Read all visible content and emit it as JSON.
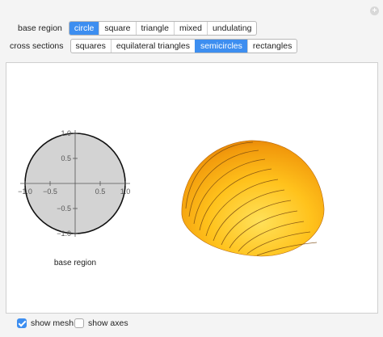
{
  "header": {
    "expand_icon": "plus-icon"
  },
  "controls": {
    "base_region": {
      "label": "base region",
      "options": [
        "circle",
        "square",
        "triangle",
        "mixed",
        "undulating"
      ],
      "selected": "circle"
    },
    "cross_sections": {
      "label": "cross sections",
      "options": [
        "squares",
        "equilateral triangles",
        "semicircles",
        "rectangles"
      ],
      "selected": "semicircles"
    }
  },
  "plot": {
    "x_ticks": [
      "−1.0",
      "−0.5",
      "0.5",
      "1.0"
    ],
    "y_ticks": [
      "1.0",
      "0.5",
      "−0.5",
      "−1.0"
    ],
    "caption": "base region"
  },
  "options": {
    "show_mesh": {
      "label": "show mesh",
      "checked": true
    },
    "show_axes": {
      "label": "show axes",
      "checked": false
    }
  },
  "colors": {
    "accent": "#3d8ef0",
    "disk_fill": "#d3d3d3",
    "solid_light": "#ffd23a",
    "solid_dark": "#e07a05"
  }
}
